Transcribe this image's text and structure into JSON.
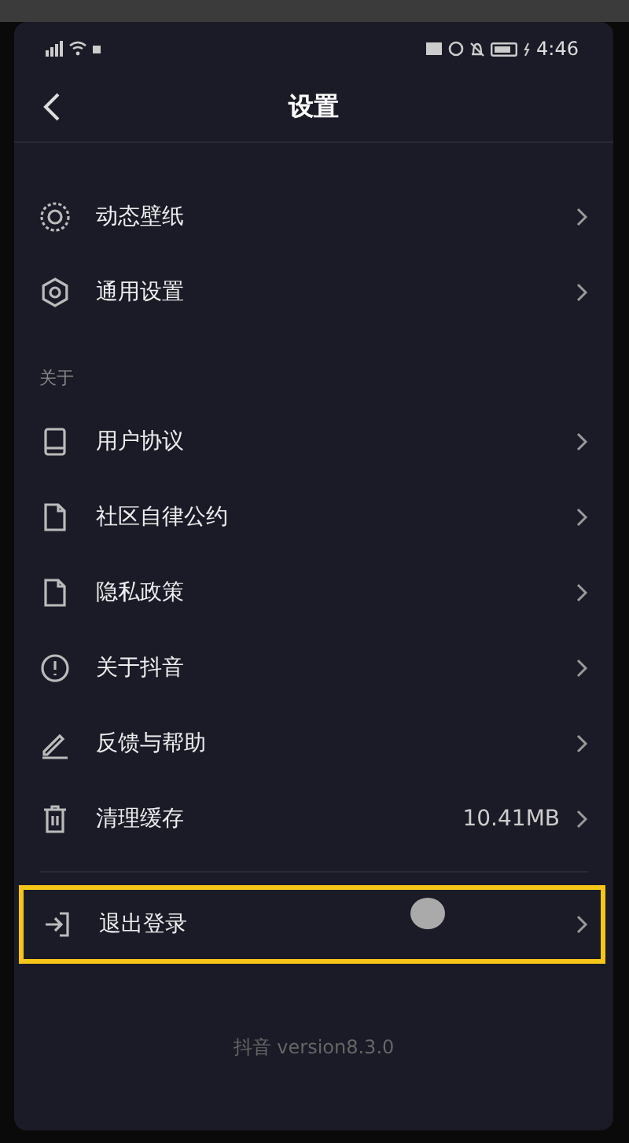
{
  "status_bar": {
    "time": "4:46"
  },
  "header": {
    "title": "设置"
  },
  "sections": [
    {
      "items": [
        {
          "kind": "wallpaper",
          "label": "动态壁纸"
        },
        {
          "kind": "gear",
          "label": "通用设置"
        }
      ]
    },
    {
      "title": "关于",
      "items": [
        {
          "kind": "book",
          "label": "用户协议"
        },
        {
          "kind": "doc",
          "label": "社区自律公约"
        },
        {
          "kind": "doc",
          "label": "隐私政策"
        },
        {
          "kind": "info",
          "label": "关于抖音"
        },
        {
          "kind": "pen",
          "label": "反馈与帮助"
        },
        {
          "kind": "trash",
          "label": "清理缓存",
          "value": "10.41MB"
        }
      ]
    }
  ],
  "logout": {
    "kind": "exit",
    "label": "退出登录",
    "highlighted": true,
    "touched": true
  },
  "footer": "抖音 version8.3.0"
}
